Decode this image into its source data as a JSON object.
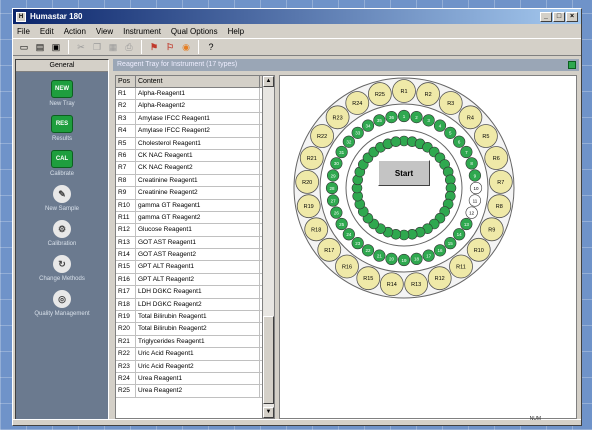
{
  "window": {
    "title": "Humastar 180",
    "controls": [
      "_",
      "□",
      "×"
    ]
  },
  "menu": [
    "File",
    "Edit",
    "Action",
    "View",
    "Instrument",
    "Qual Options",
    "Help"
  ],
  "toolbar": {
    "icons": [
      "new-icon",
      "open-icon",
      "save-icon",
      "cut-icon",
      "copy-icon",
      "paste-icon",
      "print-icon",
      "flag-red-icon",
      "flag-icon",
      "stop-icon",
      "help-icon"
    ]
  },
  "left_panel": {
    "header": "General",
    "items": [
      {
        "label": "New Tray",
        "icon_text": "NEW"
      },
      {
        "label": "Results",
        "icon_text": "RES"
      },
      {
        "label": "Calibrate",
        "icon_text": "CAL"
      },
      {
        "label": "New Sample",
        "icon_text": "✎"
      },
      {
        "label": "Calibration",
        "icon_text": "⚙"
      },
      {
        "label": "Change Methods",
        "icon_text": "↻"
      },
      {
        "label": "Quality Management",
        "icon_text": "◎"
      }
    ]
  },
  "infobar": {
    "text": "Reagent Tray for Instrument (17 types)"
  },
  "table": {
    "headers": [
      "Pos",
      "Content"
    ],
    "rows": [
      [
        "R1",
        "Alpha-Reagent1"
      ],
      [
        "R2",
        "Alpha-Reagent2"
      ],
      [
        "R3",
        "Amylase IFCC Reagent1"
      ],
      [
        "R4",
        "Amylase IFCC Reagent2"
      ],
      [
        "R5",
        "Cholesterol Reagent1"
      ],
      [
        "R6",
        "CK NAC Reagent1"
      ],
      [
        "R7",
        "CK NAC Reagent2"
      ],
      [
        "R8",
        "Creatinine Reagent1"
      ],
      [
        "R9",
        "Creatinine Reagent2"
      ],
      [
        "R10",
        "gamma GT Reagent1"
      ],
      [
        "R11",
        "gamma GT Reagent2"
      ],
      [
        "R12",
        "Glucose Reagent1"
      ],
      [
        "R13",
        "GOT AST Reagent1"
      ],
      [
        "R14",
        "GOT AST Reagent2"
      ],
      [
        "R15",
        "GPT ALT Reagent1"
      ],
      [
        "R16",
        "GPT ALT Reagent2"
      ],
      [
        "R17",
        "LDH DGKC Reagent1"
      ],
      [
        "R18",
        "LDH DGKC Reagent2"
      ],
      [
        "R19",
        "Total Bilirubin Reagent1"
      ],
      [
        "R20",
        "Total Bilirubin Reagent2"
      ],
      [
        "R21",
        "Triglycerides Reagent1"
      ],
      [
        "R22",
        "Uric Acid Reagent1"
      ],
      [
        "R23",
        "Uric Acid Reagent2"
      ],
      [
        "R24",
        "Urea Reagent1"
      ],
      [
        "R25",
        "Urea Reagent2"
      ]
    ]
  },
  "tray": {
    "start_label": "Start",
    "outer_labels": [
      "R1",
      "R2",
      "R3",
      "R4",
      "R5",
      "R6",
      "R7",
      "R8",
      "R9",
      "R10",
      "R11",
      "R12",
      "R13",
      "R14",
      "R15",
      "R16",
      "R17",
      "R18",
      "R19",
      "R20",
      "R21",
      "R22",
      "R23",
      "R24",
      "R25"
    ],
    "middle_labels": [
      "1",
      "2",
      "3",
      "4",
      "5",
      "6",
      "7",
      "8",
      "9",
      "10",
      "11",
      "12",
      "13",
      "14",
      "15",
      "16",
      "17",
      "18",
      "19",
      "20",
      "21",
      "22",
      "23",
      "24",
      "25",
      "26",
      "27",
      "28",
      "29",
      "30",
      "31",
      "32",
      "33",
      "34",
      "35",
      "36"
    ],
    "colors": {
      "reagent": "#efe9a8",
      "sample": "#2fa84f",
      "empty": "#ffffff"
    }
  },
  "status": {
    "text": "NUM"
  }
}
